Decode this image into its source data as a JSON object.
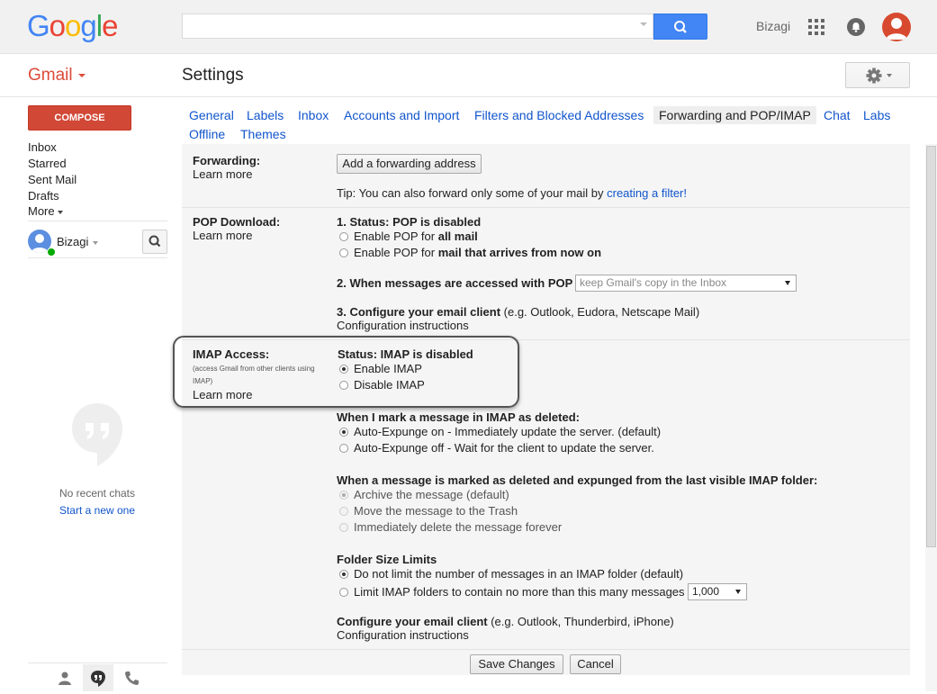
{
  "header": {
    "logo_letters": [
      {
        "ch": "G",
        "color": "#4285f4"
      },
      {
        "ch": "o",
        "color": "#ea4335"
      },
      {
        "ch": "o",
        "color": "#fbbc05"
      },
      {
        "ch": "g",
        "color": "#4285f4"
      },
      {
        "ch": "l",
        "color": "#34a853"
      },
      {
        "ch": "e",
        "color": "#ea4335"
      }
    ],
    "search_value": "",
    "account_name": "Bizagi",
    "icons": [
      "search-icon",
      "apps-grid-icon",
      "notifications-icon",
      "avatar"
    ]
  },
  "app": {
    "brand": "Gmail",
    "page_title": "Settings",
    "compose_label": "COMPOSE"
  },
  "nav": {
    "items": [
      "Inbox",
      "Starred",
      "Sent Mail",
      "Drafts",
      "More"
    ]
  },
  "chat": {
    "user": "Bizagi",
    "no_recent": "No recent chats",
    "start_new": "Start a new one"
  },
  "tabs": {
    "items": [
      "General",
      "Labels",
      "Inbox",
      "Accounts and Import",
      "Filters and Blocked Addresses",
      "Forwarding and POP/IMAP",
      "Chat",
      "Labs",
      "Offline",
      "Themes"
    ],
    "active": "Forwarding and POP/IMAP"
  },
  "forwarding": {
    "label": "Forwarding:",
    "learn_more": "Learn more",
    "add_button": "Add a forwarding address",
    "tip_prefix": "Tip: You can also forward only some of your mail by ",
    "tip_link": "creating a filter!"
  },
  "pop": {
    "label": "POP Download:",
    "learn_more": "Learn more",
    "status": "1. Status: POP is disabled",
    "opt1_prefix": "Enable POP for ",
    "opt1_bold": "all mail",
    "opt2_prefix": "Enable POP for ",
    "opt2_bold": "mail that arrives from now on",
    "accessed_label": "2. When messages are accessed with POP",
    "accessed_select": "keep Gmail's copy in the Inbox",
    "configure_bold": "3. Configure your email client",
    "configure_rest": " (e.g. Outlook, Eudora, Netscape Mail)",
    "configure_link": "Configuration instructions"
  },
  "imap": {
    "label": "IMAP Access:",
    "sublabel": "(access Gmail from other clients using IMAP)",
    "learn_more": "Learn more",
    "status": "Status: IMAP is disabled",
    "enable": "Enable IMAP",
    "disable": "Disable IMAP",
    "deleted_heading": "When I mark a message in IMAP as deleted:",
    "deleted_opt1": "Auto-Expunge on - Immediately update the server. (default)",
    "deleted_opt2": "Auto-Expunge off - Wait for the client to update the server.",
    "expunged_heading": "When a message is marked as deleted and expunged from the last visible IMAP folder:",
    "expunged_opt1": "Archive the message (default)",
    "expunged_opt2": "Move the message to the Trash",
    "expunged_opt3": "Immediately delete the message forever",
    "folder_heading": "Folder Size Limits",
    "folder_opt1": "Do not limit the number of messages in an IMAP folder (default)",
    "folder_opt2": "Limit IMAP folders to contain no more than this many messages",
    "folder_select": "1,000",
    "configure_bold": "Configure your email client",
    "configure_rest": " (e.g. Outlook, Thunderbird, iPhone)",
    "configure_link": "Configuration instructions"
  },
  "footer": {
    "save": "Save Changes",
    "cancel": "Cancel"
  }
}
